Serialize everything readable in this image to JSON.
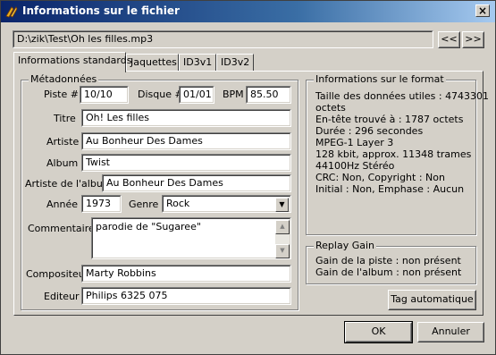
{
  "window": {
    "title": "Informations sur le fichier",
    "close_label": "×"
  },
  "path": {
    "value": "D:\\zik\\Test\\Oh les filles.mp3",
    "prev_label": "<<",
    "next_label": ">>"
  },
  "tabs": [
    {
      "label": "Informations standards",
      "active": true
    },
    {
      "label": "Jaquettes",
      "active": false
    },
    {
      "label": "ID3v1",
      "active": false
    },
    {
      "label": "ID3v2",
      "active": false
    }
  ],
  "metadata": {
    "legend": "Métadonnées",
    "track_label": "Piste #",
    "track_value": "10/10",
    "disc_label": "Disque #",
    "disc_value": "01/01",
    "bpm_label": "BPM",
    "bpm_value": "85.50",
    "title_label": "Titre",
    "title_value": "Oh! Les filles",
    "artist_label": "Artiste",
    "artist_value": "Au Bonheur Des Dames",
    "album_label": "Album",
    "album_value": "Twist",
    "album_artist_label": "Artiste de l'album",
    "album_artist_value": "Au Bonheur Des Dames",
    "year_label": "Année",
    "year_value": "1973",
    "genre_label": "Genre",
    "genre_value": "Rock",
    "comments_label": "Commentaires",
    "comments_value": "parodie de \"Sugaree\"",
    "composer_label": "Compositeur",
    "composer_value": "Marty Robbins",
    "publisher_label": "Editeur",
    "publisher_value": "Philips 6325 075"
  },
  "format_info": {
    "legend": "Informations sur le format",
    "lines": [
      "Taille des données utiles : 4743301",
      "octets",
      "En-tête trouvé à : 1787 octets",
      "Durée : 296 secondes",
      "MPEG-1 Layer 3",
      "128 kbit, approx. 11348 trames",
      "44100Hz Stéréo",
      "CRC: Non, Copyright : Non",
      "Initial : Non, Emphase : Aucun"
    ]
  },
  "replay_gain": {
    "legend": "Replay Gain",
    "lines": [
      "Gain de la piste : non présent",
      "Gain de l'album : non présent"
    ]
  },
  "buttons": {
    "auto_tag": "Tag automatique",
    "ok": "OK",
    "cancel": "Annuler"
  }
}
